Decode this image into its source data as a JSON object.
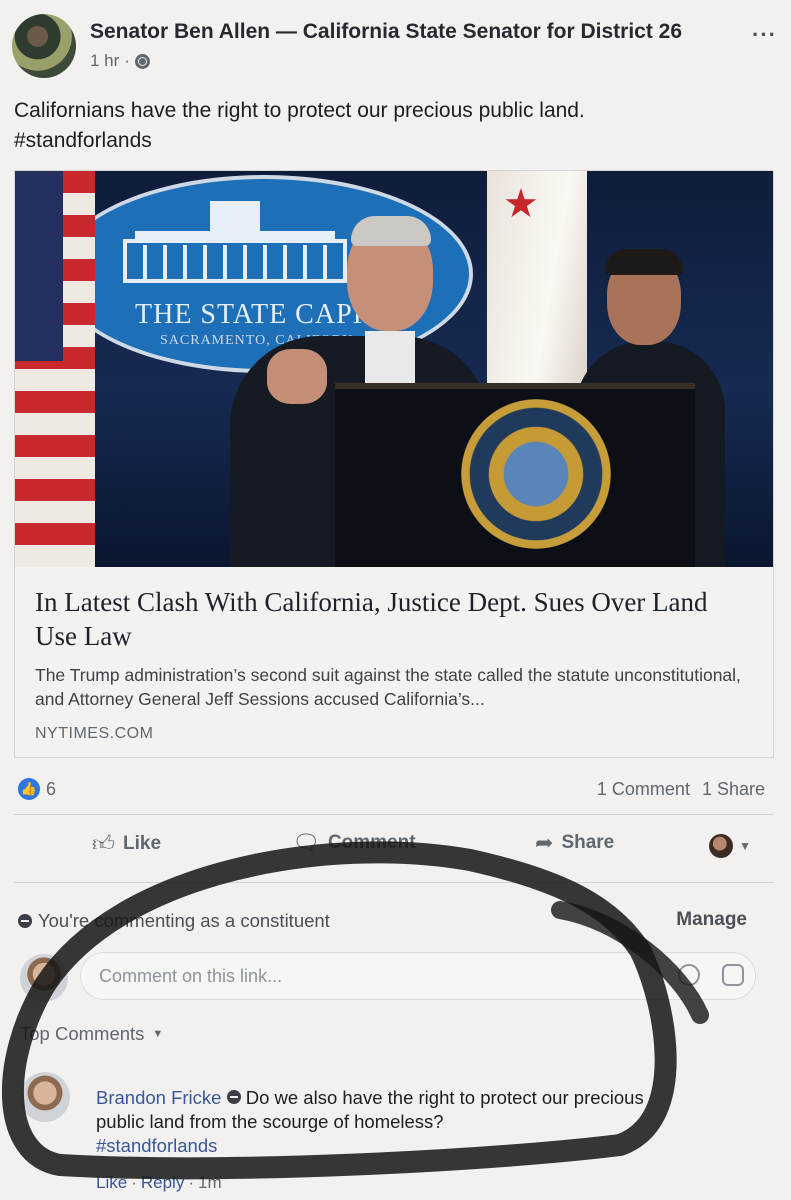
{
  "post": {
    "author": "Senator Ben Allen — California State Senator for District 26",
    "time": "1 hr",
    "dot": "·",
    "more": "···",
    "text_line1": "Californians have the right to protect our precious public land.",
    "text_line2": "#standforlands"
  },
  "link_card": {
    "seal_text_line1": "THE STATE CAPIT",
    "seal_text_line2": "SACRAMENTO, CALIFORN",
    "title": "In Latest Clash With California, Justice Dept. Sues Over Land Use Law",
    "description": "The Trump administration’s second suit against the state called the statute unconstitutional, and Attorney General Jeff Sessions accused California’s...",
    "source": "NYTIMES.COM"
  },
  "stats": {
    "likes": "6",
    "comments": "1 Comment",
    "shares": "1 Share"
  },
  "actions": {
    "like": "Like",
    "comment": "Comment",
    "share": "Share"
  },
  "commenting": {
    "notice": "You're commenting as a constituent",
    "manage": "Manage",
    "placeholder": "Comment on this link..."
  },
  "comments": {
    "sort_label": "Top Comments",
    "items": [
      {
        "author": "Brandon Fricke",
        "text": "Do we also have the right to protect our precious public land from the scourge of homeless?",
        "hashtag": "#standforlands",
        "like": "Like",
        "sep": "·",
        "reply": "Reply",
        "time": "1m"
      }
    ]
  },
  "icons": {
    "globe": "globe-icon",
    "like": "thumbs-up-icon",
    "comment": "speech-bubble-icon",
    "share": "share-arrow-icon",
    "emoji": "emoji-icon",
    "sticker": "sticker-icon"
  },
  "colors": {
    "link_blue": "#385898",
    "like_blue": "#2d74e5",
    "marker": "#111111"
  }
}
